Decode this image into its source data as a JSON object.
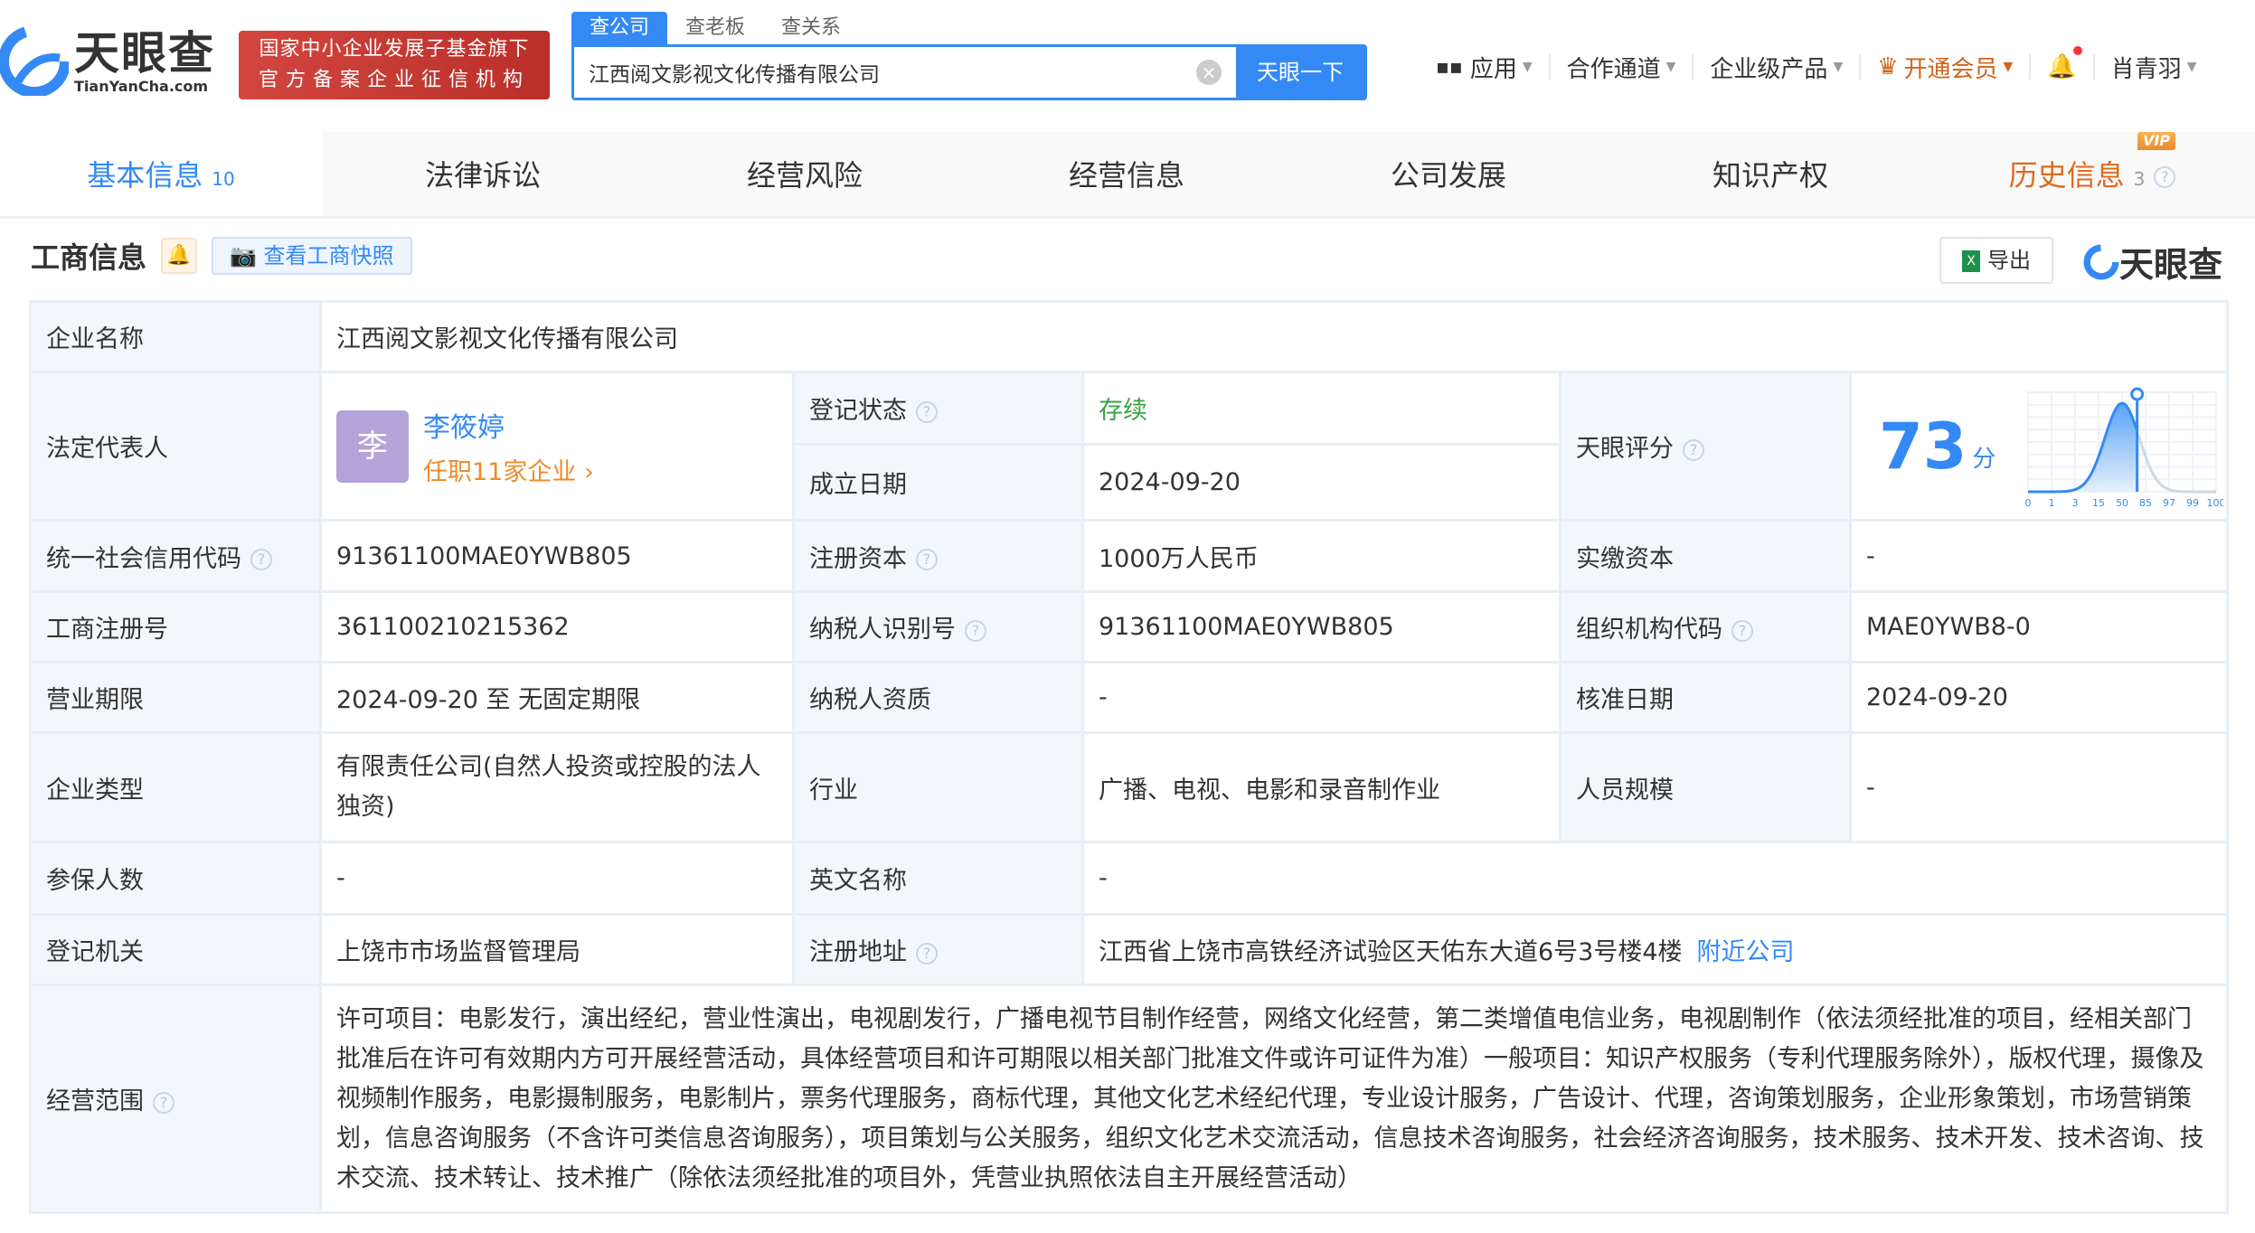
{
  "header": {
    "logo_cn": "天眼查",
    "logo_en": "TianYanCha.com",
    "badge_line1": "国家中小企业发展子基金旗下",
    "badge_line2": "官方备案企业征信机构",
    "search_tabs": [
      "查公司",
      "查老板",
      "查关系"
    ],
    "search_value": "江西阅文影视文化传播有限公司",
    "search_button": "天眼一下",
    "nav": {
      "apps": "应用",
      "partner": "合作通道",
      "enterprise": "企业级产品",
      "vip": "开通会员",
      "user": "肖青羽"
    },
    "colors": {
      "accent": "#3489f5",
      "vip": "#d0641a",
      "badge": "#c73a34"
    }
  },
  "tabs": [
    {
      "label": "基本信息",
      "count": "10"
    },
    {
      "label": "法律诉讼"
    },
    {
      "label": "经营风险"
    },
    {
      "label": "经营信息"
    },
    {
      "label": "公司发展"
    },
    {
      "label": "知识产权"
    },
    {
      "label": "历史信息",
      "count": "3",
      "badge": "VIP"
    }
  ],
  "section": {
    "title": "工商信息",
    "snapshot": "查看工商快照",
    "export": "导出",
    "logo": "天眼查"
  },
  "info": {
    "company_name_label": "企业名称",
    "company_name": "江西阅文影视文化传播有限公司",
    "legal_rep_label": "法定代表人",
    "legal_rep_avatar": "李",
    "legal_rep": "李筱婷",
    "legal_rep_jobs": "任职11家企业 ›",
    "status_label": "登记状态",
    "status": "存续",
    "founded_label": "成立日期",
    "founded": "2024-09-20",
    "score_label": "天眼评分",
    "score": "73",
    "score_unit": "分",
    "credit_code_label": "统一社会信用代码",
    "credit_code": "91361100MAE0YWB805",
    "reg_capital_label": "注册资本",
    "reg_capital": "1000万人民币",
    "paid_capital_label": "实缴资本",
    "paid_capital": "-",
    "reg_no_label": "工商注册号",
    "reg_no": "361100210215362",
    "taxpayer_id_label": "纳税人识别号",
    "taxpayer_id": "91361100MAE0YWB805",
    "org_code_label": "组织机构代码",
    "org_code": "MAE0YWB8-0",
    "term_label": "营业期限",
    "term": "2024-09-20 至 无固定期限",
    "taxpayer_qual_label": "纳税人资质",
    "taxpayer_qual": "-",
    "approve_date_label": "核准日期",
    "approve_date": "2024-09-20",
    "type_label": "企业类型",
    "type": "有限责任公司(自然人投资或控股的法人独资)",
    "industry_label": "行业",
    "industry": "广播、电视、电影和录音制作业",
    "staff_label": "人员规模",
    "staff": "-",
    "insured_label": "参保人数",
    "insured": "-",
    "en_name_label": "英文名称",
    "en_name": "-",
    "authority_label": "登记机关",
    "authority": "上饶市市场监督管理局",
    "address_label": "注册地址",
    "address": "江西省上饶市高铁经济试验区天佑东大道6号3号楼4楼",
    "nearby": "附近公司",
    "scope_label": "经营范围",
    "scope": "许可项目：电影发行，演出经纪，营业性演出，电视剧发行，广播电视节目制作经营，网络文化经营，第二类增值电信业务，电视剧制作（依法须经批准的项目，经相关部门批准后在许可有效期内方可开展经营活动，具体经营项目和许可期限以相关部门批准文件或许可证件为准）一般项目：知识产权服务（专利代理服务除外），版权代理，摄像及视频制作服务，电影摄制服务，电影制片，票务代理服务，商标代理，其他文化艺术经纪代理，专业设计服务，广告设计、代理，咨询策划服务，企业形象策划，市场营销策划，信息咨询服务（不含许可类信息咨询服务），项目策划与公关服务，组织文化艺术交流活动，信息技术咨询服务，社会经济咨询服务，技术服务、技术开发、技术咨询、技术交流、技术转让、技术推广（除依法须经批准的项目外，凭营业执照依法自主开展经营活动）"
  },
  "chart_data": {
    "type": "area",
    "x_ticks": [
      "0",
      "1",
      "3",
      "15",
      "50",
      "85",
      "97",
      "99",
      "100"
    ],
    "marker_score": 73,
    "grid": true
  }
}
